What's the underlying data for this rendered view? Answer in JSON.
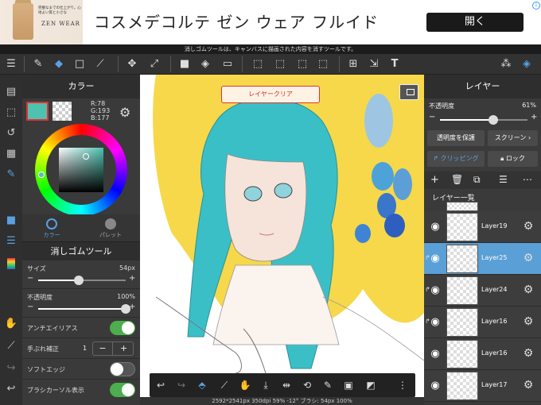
{
  "ad": {
    "brand_line": "完璧なまでの仕上がり。心地よい質と小さな",
    "brand_name": "ZEN WEAR",
    "title": "コスメデコルテ ゼン ウェア フルイド",
    "button": "開く"
  },
  "notice": "消しゴムツールは、キャンバスに描画された内容を消すツールです。",
  "color_panel": {
    "title": "カラー",
    "r": "R:78",
    "g": "G:193",
    "b": "B:177",
    "main_color": "#4ec1b1",
    "tabs": [
      {
        "label": "カラー"
      },
      {
        "label": "パレット"
      }
    ]
  },
  "tool_panel": {
    "title": "消しゴムツール",
    "size_label": "サイズ",
    "size_value": "54px",
    "size_level": 0.46,
    "opacity_label": "不透明度",
    "opacity_value": "100%",
    "opacity_level": 1.0,
    "antialias_label": "アンチエイリアス",
    "antialias_on": true,
    "stabilizer_label": "手ぶれ補正",
    "stabilizer_value": "1",
    "soft_edge_label": "ソフトエッジ",
    "soft_edge_on": false,
    "brush_cursor_label": "ブラシカーソル表示",
    "brush_cursor_on": true
  },
  "canvas": {
    "clear_layer_button": "レイヤークリア",
    "status": "2592*2541px 350dpi 59% -12° ブラシ: 54px 100%"
  },
  "layer_panel": {
    "title": "レイヤー",
    "opacity_label": "不透明度",
    "opacity_value": "61%",
    "opacity_level": 0.61,
    "protect_alpha": "透明度を保護",
    "blend_mode": "スクリーン",
    "clipping": "クリッピング",
    "lock": "ロック",
    "list_title": "レイヤー一覧",
    "layers": [
      {
        "name": "Layer19",
        "selected": false,
        "clipped": false
      },
      {
        "name": "Layer25",
        "selected": true,
        "clipped": true
      },
      {
        "name": "Layer24",
        "selected": false,
        "clipped": true
      },
      {
        "name": "Layer16",
        "selected": false,
        "clipped": true
      },
      {
        "name": "Layer16",
        "selected": false,
        "clipped": false
      },
      {
        "name": "Layer17",
        "selected": false,
        "clipped": false
      }
    ]
  },
  "colors": {
    "accent": "#5a9fd6",
    "toggle_on": "#4cae4c",
    "art_yellow": "#f6d84a",
    "art_teal": "#3bbfc7",
    "art_blue": "#2f6fd0"
  }
}
